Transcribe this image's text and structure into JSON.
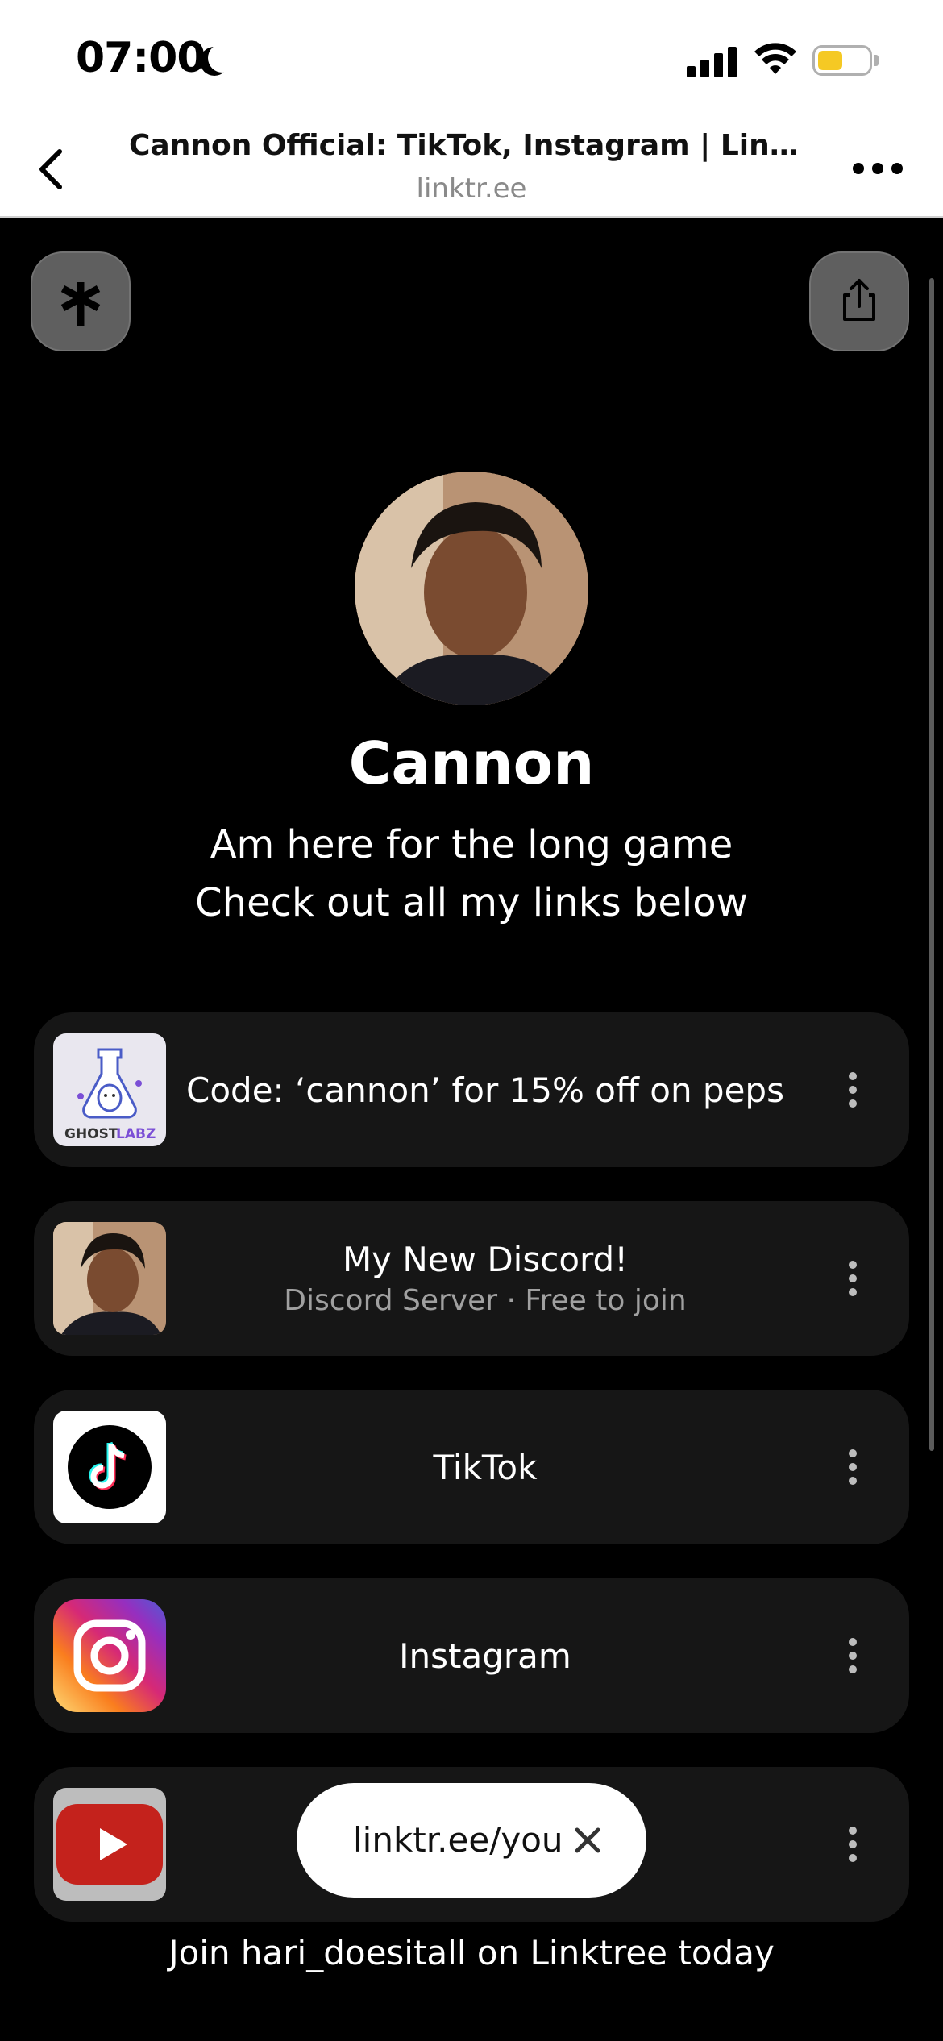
{
  "status_bar": {
    "time": "07:00",
    "battery_color": "#f5c924"
  },
  "browser": {
    "title": "Cannon Official: TikTok, Instagram | Linkt…",
    "url": "linktr.ee"
  },
  "profile": {
    "name": "Cannon",
    "bio_line1": "Am here for the long game",
    "bio_line2": "Check out all my links below"
  },
  "links": [
    {
      "title": "Code: ‘cannon’ for 15% off on peps",
      "subtitle": "",
      "thumb": "ghostlabz-logo",
      "thumb_text_a": "GHOST",
      "thumb_text_b": "LABZ"
    },
    {
      "title": "My New Discord!",
      "subtitle": "Discord Server · Free to join",
      "thumb": "profile-photo"
    },
    {
      "title": "TikTok",
      "subtitle": "",
      "thumb": "tiktok-logo"
    },
    {
      "title": "Instagram",
      "subtitle": "",
      "thumb": "instagram-logo"
    },
    {
      "title": "",
      "subtitle": "",
      "thumb": "youtube-logo"
    }
  ],
  "claim_pill": {
    "text": "linktr.ee/you"
  },
  "footer": {
    "text": "Join hari_doesitall on Linktree today"
  },
  "colors": {
    "background": "#000000",
    "card": "#161616",
    "accent_purple": "#7b4fd6"
  }
}
